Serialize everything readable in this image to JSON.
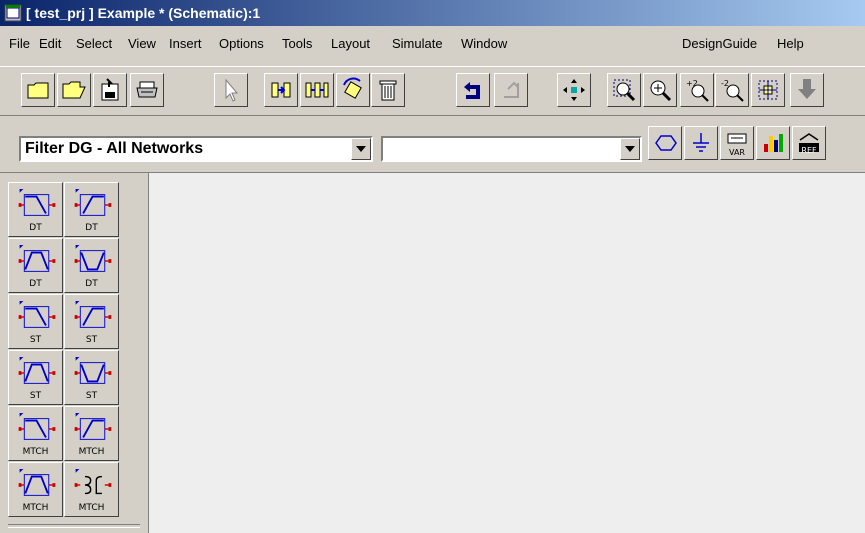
{
  "window": {
    "title": "[ test_prj ] Example * (Schematic):1",
    "icon": "ads-app-icon"
  },
  "menu": {
    "file": "File",
    "edit": "Edit",
    "select": "Select",
    "view": "View",
    "insert": "Insert",
    "options": "Options",
    "tools": "Tools",
    "layout": "Layout",
    "simulate": "Simulate",
    "window": "Window",
    "designguide": "DesignGuide",
    "help": "Help"
  },
  "toolbar": {
    "icons": [
      "new-icon",
      "open-icon",
      "save-icon",
      "print-icon",
      "select-arrow-icon",
      "insert-component-icon",
      "insert-component2-icon",
      "rotate-icon",
      "delete-icon",
      "undo-icon",
      "redo-icon",
      "pan-icon",
      "zoom-area-icon",
      "zoom-in-icon",
      "zoom-plus2-icon",
      "zoom-minus2-icon",
      "zoom-fit-icon",
      "push-down-icon"
    ]
  },
  "library": {
    "palette_selected": "Filter DG - All Networks",
    "component_selected": "",
    "tools": [
      "port-icon",
      "ground-icon",
      "var-icon",
      "simulation-icon",
      "ref-icon"
    ],
    "var_label": "VAR",
    "ref_label": "REF"
  },
  "palette": {
    "items": [
      {
        "label": "DT",
        "shape": "lowpass"
      },
      {
        "label": "DT",
        "shape": "highpass"
      },
      {
        "label": "DT",
        "shape": "bandpass"
      },
      {
        "label": "DT",
        "shape": "bandstop"
      },
      {
        "label": "ST",
        "shape": "lowpass"
      },
      {
        "label": "ST",
        "shape": "highpass"
      },
      {
        "label": "ST",
        "shape": "bandpass"
      },
      {
        "label": "ST",
        "shape": "bandstop"
      },
      {
        "label": "MTCH",
        "shape": "lowpass"
      },
      {
        "label": "MTCH",
        "shape": "highpass"
      },
      {
        "label": "MTCH",
        "shape": "bandpass"
      },
      {
        "label": "MTCH",
        "shape": "coupler"
      }
    ]
  },
  "colors": {
    "title_start": "#0a246a",
    "title_end": "#a6caf0",
    "face": "#d4d0c8",
    "canvas": "#eeeeee",
    "accent_blue": "#0000cc",
    "pin_red": "#cc0000"
  }
}
